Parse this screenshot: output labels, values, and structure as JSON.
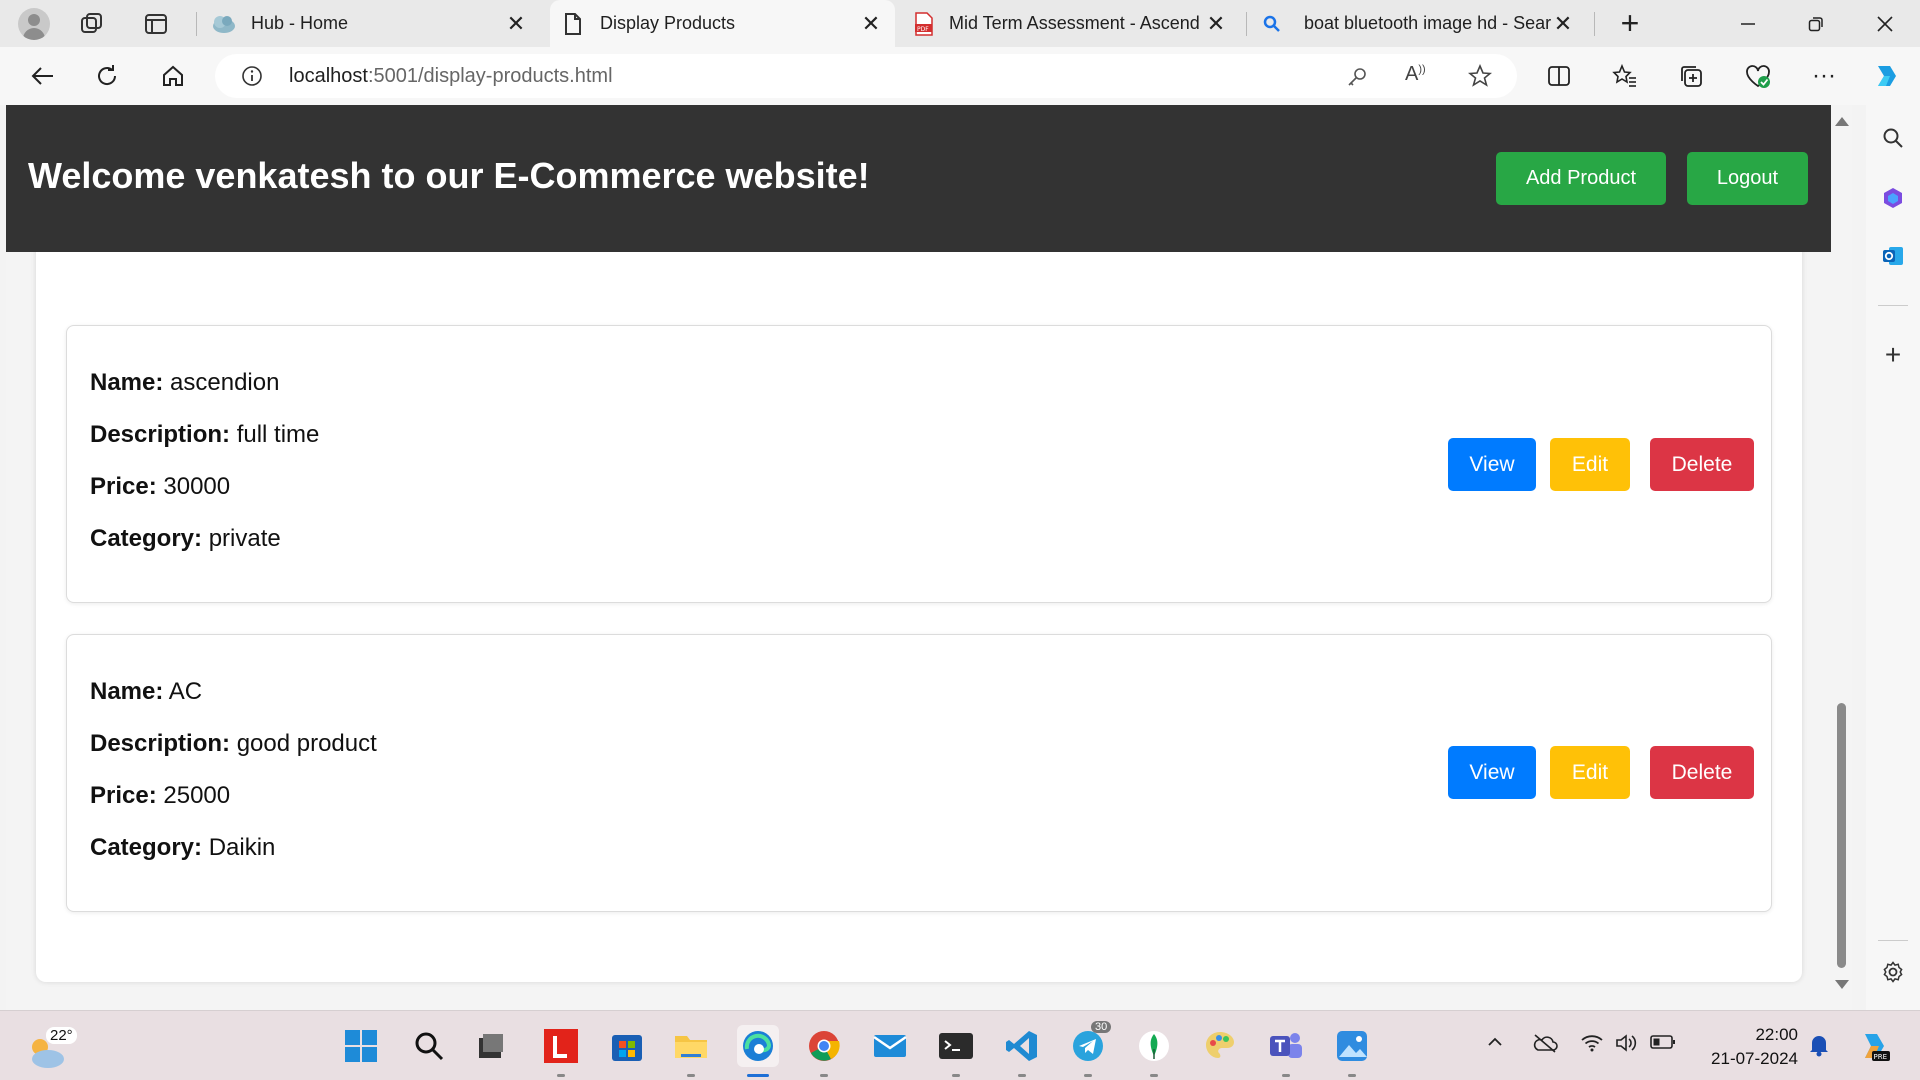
{
  "browser": {
    "tabs": [
      {
        "label": "Hub - Home",
        "icon": "cloud-hub-icon",
        "active": false
      },
      {
        "label": "Display Products",
        "icon": "page-icon",
        "active": true
      },
      {
        "label": "Mid Term Assessment - Ascendi",
        "icon": "pdf-icon",
        "active": false
      },
      {
        "label": "boat bluetooth image hd - Sear",
        "icon": "search-icon",
        "active": false
      }
    ],
    "url_host": "localhost",
    "url_path": ":5001/display-products.html"
  },
  "page": {
    "title": "Welcome venkatesh to our E-Commerce website!",
    "add_product_label": "Add Product",
    "logout_label": "Logout",
    "field_labels": {
      "name": "Name:",
      "description": "Description:",
      "price": "Price:",
      "category": "Category:"
    },
    "actions": {
      "view": "View",
      "edit": "Edit",
      "delete": "Delete"
    },
    "products": [
      {
        "name": "ascendion",
        "description": "full time",
        "price": "30000",
        "category": "private"
      },
      {
        "name": "AC",
        "description": "good product",
        "price": "25000",
        "category": "Daikin"
      }
    ]
  },
  "taskbar": {
    "weather": "22°",
    "telegram_badge": "30",
    "time": "22:00",
    "date": "21-07-2024"
  },
  "colors": {
    "header_bg": "#333333",
    "green": "#28a745",
    "blue": "#007bff",
    "yellow": "#ffc107",
    "red": "#dc3545"
  }
}
